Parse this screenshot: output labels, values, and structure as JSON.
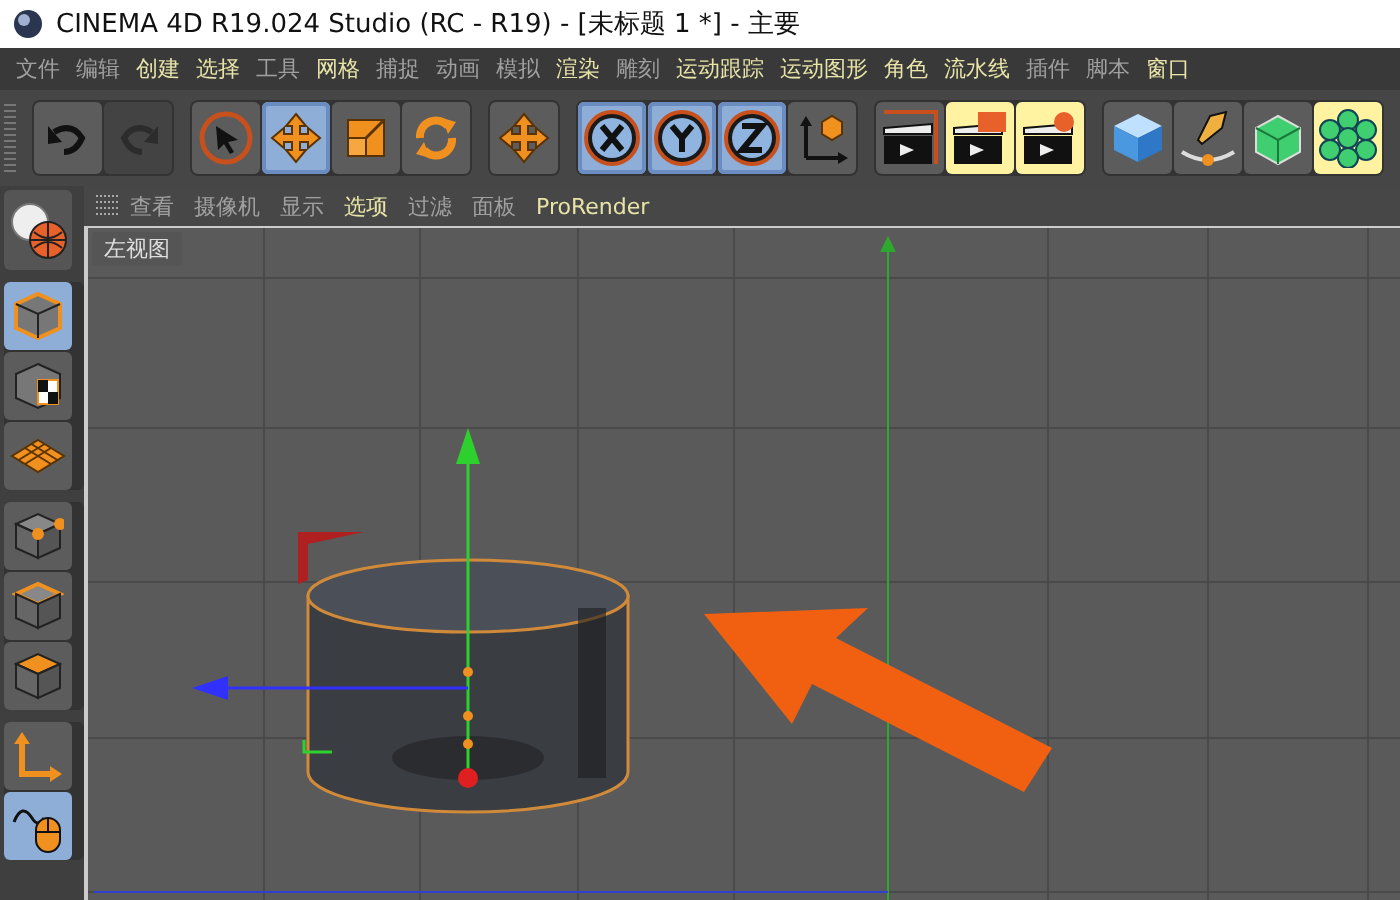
{
  "window": {
    "title": "CINEMA 4D R19.024 Studio (RC - R19) - [未标题 1 *] - 主要"
  },
  "menu": [
    {
      "label": "文件",
      "highlighted": false
    },
    {
      "label": "编辑",
      "highlighted": false
    },
    {
      "label": "创建",
      "highlighted": true
    },
    {
      "label": "选择",
      "highlighted": true
    },
    {
      "label": "工具",
      "highlighted": false
    },
    {
      "label": "网格",
      "highlighted": true
    },
    {
      "label": "捕捉",
      "highlighted": false
    },
    {
      "label": "动画",
      "highlighted": false
    },
    {
      "label": "模拟",
      "highlighted": false
    },
    {
      "label": "渲染",
      "highlighted": true
    },
    {
      "label": "雕刻",
      "highlighted": false
    },
    {
      "label": "运动跟踪",
      "highlighted": true
    },
    {
      "label": "运动图形",
      "highlighted": true
    },
    {
      "label": "角色",
      "highlighted": true
    },
    {
      "label": "流水线",
      "highlighted": true
    },
    {
      "label": "插件",
      "highlighted": false
    },
    {
      "label": "脚本",
      "highlighted": false
    },
    {
      "label": "窗口",
      "highlighted": true
    }
  ],
  "toolbar": [
    [
      {
        "kind": "undo",
        "selected": false,
        "disabled": false,
        "highlighted": false
      },
      {
        "kind": "redo",
        "selected": false,
        "disabled": true,
        "highlighted": false
      }
    ],
    [
      {
        "kind": "select",
        "selected": false,
        "disabled": false,
        "highlighted": false
      },
      {
        "kind": "move",
        "selected": true,
        "disabled": false,
        "highlighted": false
      },
      {
        "kind": "scale",
        "selected": false,
        "disabled": false,
        "highlighted": false
      },
      {
        "kind": "rotate",
        "selected": false,
        "disabled": false,
        "highlighted": false
      }
    ],
    [
      {
        "kind": "move",
        "selected": false,
        "disabled": false,
        "highlighted": false
      }
    ],
    [
      {
        "kind": "x",
        "selected": true,
        "disabled": false,
        "highlighted": false
      },
      {
        "kind": "y",
        "selected": true,
        "disabled": false,
        "highlighted": false
      },
      {
        "kind": "z",
        "selected": true,
        "disabled": false,
        "highlighted": false
      },
      {
        "kind": "coords",
        "selected": false,
        "disabled": false,
        "highlighted": false
      }
    ],
    [
      {
        "kind": "render-view",
        "selected": false,
        "disabled": false,
        "highlighted": false
      },
      {
        "kind": "render-picture",
        "selected": false,
        "disabled": false,
        "highlighted": true
      },
      {
        "kind": "render-settings",
        "selected": false,
        "disabled": false,
        "highlighted": true
      }
    ],
    [
      {
        "kind": "cube",
        "selected": false,
        "disabled": false,
        "highlighted": false
      },
      {
        "kind": "pen",
        "selected": false,
        "disabled": false,
        "highlighted": false
      },
      {
        "kind": "polygon",
        "selected": false,
        "disabled": false,
        "highlighted": false
      },
      {
        "kind": "cloner",
        "selected": false,
        "disabled": false,
        "highlighted": true
      }
    ]
  ],
  "viewport_menu": [
    {
      "label": "查看",
      "highlighted": false
    },
    {
      "label": "摄像机",
      "highlighted": false
    },
    {
      "label": "显示",
      "highlighted": false
    },
    {
      "label": "选项",
      "highlighted": true
    },
    {
      "label": "过滤",
      "highlighted": false
    },
    {
      "label": "面板",
      "highlighted": false
    },
    {
      "label": "ProRender",
      "highlighted": true
    }
  ],
  "viewport": {
    "label": "左视图"
  },
  "palette": [
    [
      {
        "kind": "model",
        "selected": true
      },
      {
        "kind": "texture",
        "selected": false
      },
      {
        "kind": "workplane",
        "selected": false
      }
    ],
    [
      {
        "kind": "points",
        "selected": false
      },
      {
        "kind": "edges",
        "selected": false
      },
      {
        "kind": "polygons",
        "selected": false
      }
    ],
    [
      {
        "kind": "axis",
        "selected": false
      },
      {
        "kind": "tweak",
        "selected": true
      }
    ]
  ]
}
